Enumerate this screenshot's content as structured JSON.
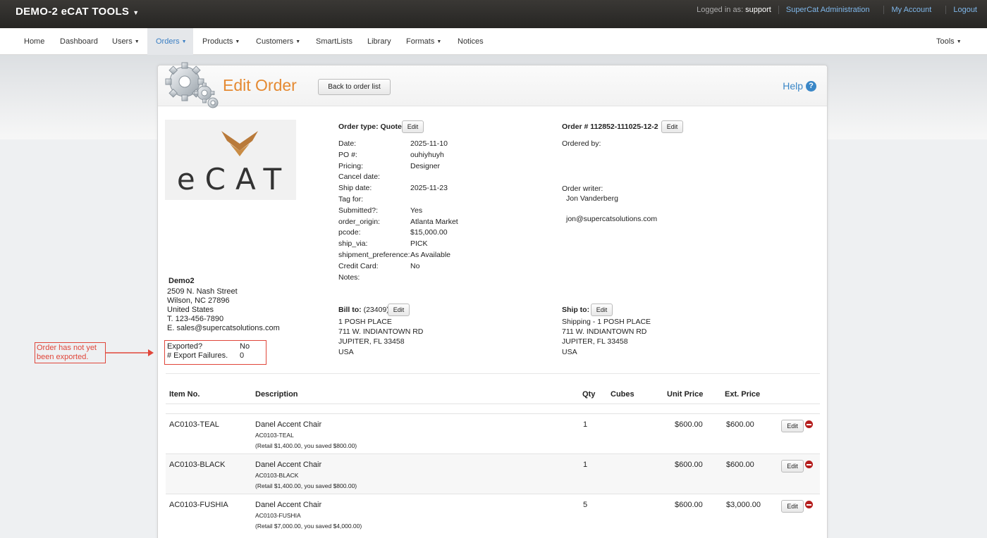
{
  "topbar": {
    "brand": "DEMO-2 eCAT TOOLS",
    "logged_in_label": "Logged in as:",
    "username": "support",
    "links": [
      "SuperCat Administration",
      "My Account",
      "Logout"
    ]
  },
  "nav": {
    "items": [
      "Home",
      "Dashboard",
      "Users",
      "Orders",
      "Products",
      "Customers",
      "SmartLists",
      "Library",
      "Formats",
      "Notices"
    ],
    "active": "Orders",
    "tools": "Tools"
  },
  "header": {
    "title": "Edit Order",
    "back_button": "Back to order list",
    "help": "Help",
    "help_icon": "?"
  },
  "company": {
    "logo_text": "eCAT",
    "name": "Demo2",
    "address": [
      "2509 N. Nash Street",
      "Wilson, NC 27896",
      "United States",
      "T. 123-456-7890",
      "E. sales@supercatsolutions.com"
    ],
    "exported_label": "Exported?",
    "exported_value": "No",
    "failures_label": "# Export Failures.",
    "failures_value": "0"
  },
  "callout": {
    "text": "Order has not yet been exported."
  },
  "order": {
    "type_label": "Order type: Quote",
    "edit": "Edit",
    "fields": [
      {
        "label": "Date:",
        "value": "2025-11-10"
      },
      {
        "label": "PO #:",
        "value": "ouhiyhuyh"
      },
      {
        "label": "Pricing:",
        "value": "Designer"
      },
      {
        "label": "Cancel date:",
        "value": ""
      },
      {
        "label": "Ship date:",
        "value": "2025-11-23"
      },
      {
        "label": "Tag for:",
        "value": ""
      },
      {
        "label": "Submitted?:",
        "value": "Yes"
      },
      {
        "label": "order_origin:",
        "value": "Atlanta Market"
      },
      {
        "label": "pcode:",
        "value": "$15,000.00"
      },
      {
        "label": "ship_via:",
        "value": "PICK"
      },
      {
        "label": "shipment_preference:",
        "value": "As Available"
      },
      {
        "label": "Credit Card:",
        "value": "No"
      },
      {
        "label": "Notes:",
        "value": ""
      }
    ],
    "number_label": "Order # 112852-111025-12-2",
    "ordered_by": "Ordered by:",
    "writer_label": "Order writer:",
    "writer_name": "Jon Vanderberg",
    "writer_email": "jon@supercatsolutions.com"
  },
  "bill_to": {
    "label": "Bill to:",
    "account": "(23409)",
    "lines": [
      "1 POSH PLACE",
      "711 W. INDIANTOWN RD",
      "JUPITER, FL 33458",
      "USA"
    ]
  },
  "ship_to": {
    "label": "Ship to:",
    "lines": [
      "Shipping - 1 POSH PLACE",
      "711 W. INDIANTOWN RD",
      "JUPITER, FL 33458",
      "USA"
    ]
  },
  "table": {
    "headers": [
      "Item No.",
      "Description",
      "Qty",
      "Cubes",
      "Unit Price",
      "Ext. Price"
    ],
    "rows": [
      {
        "item": "AC0103-TEAL",
        "desc": "Danel Accent Chair",
        "sku": "AC0103-TEAL",
        "retail": "(Retail $1,400.00, you saved $800.00)",
        "qty": "1",
        "cubes": "",
        "unit": "$600.00",
        "ext": "$600.00"
      },
      {
        "item": "AC0103-BLACK",
        "desc": "Danel Accent Chair",
        "sku": "AC0103-BLACK",
        "retail": "(Retail $1,400.00, you saved $800.00)",
        "qty": "1",
        "cubes": "",
        "unit": "$600.00",
        "ext": "$600.00"
      },
      {
        "item": "AC0103-FUSHIA",
        "desc": "Danel Accent Chair",
        "sku": "AC0103-FUSHIA",
        "retail": "(Retail $7,000.00, you saved $4,000.00)",
        "qty": "5",
        "cubes": "",
        "unit": "$600.00",
        "ext": "$3,000.00"
      }
    ],
    "edit": "Edit"
  },
  "colors": {
    "accent_orange": "#e58a32",
    "link_blue": "#3a7ec3",
    "annotation_red": "#e0463a"
  }
}
